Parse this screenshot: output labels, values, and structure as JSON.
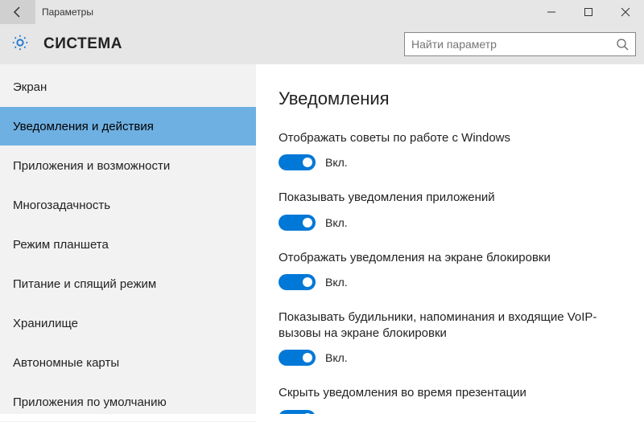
{
  "window": {
    "title": "Параметры"
  },
  "header": {
    "title": "СИСТЕМА"
  },
  "search": {
    "placeholder": "Найти параметр"
  },
  "sidebar": {
    "items": [
      {
        "label": "Экран"
      },
      {
        "label": "Уведомления и действия"
      },
      {
        "label": "Приложения и возможности"
      },
      {
        "label": "Многозадачность"
      },
      {
        "label": "Режим планшета"
      },
      {
        "label": "Питание и спящий режим"
      },
      {
        "label": "Хранилище"
      },
      {
        "label": "Автономные карты"
      },
      {
        "label": "Приложения по умолчанию"
      }
    ]
  },
  "main": {
    "heading": "Уведомления",
    "toggle_on_label": "Вкл.",
    "settings": [
      {
        "label": "Отображать советы по работе с Windows"
      },
      {
        "label": "Показывать уведомления приложений"
      },
      {
        "label": "Отображать уведомления на экране блокировки"
      },
      {
        "label": "Показывать будильники, напоминания и входящие VoIP-вызовы на экране блокировки"
      },
      {
        "label": "Скрыть уведомления во время презентации"
      }
    ]
  }
}
